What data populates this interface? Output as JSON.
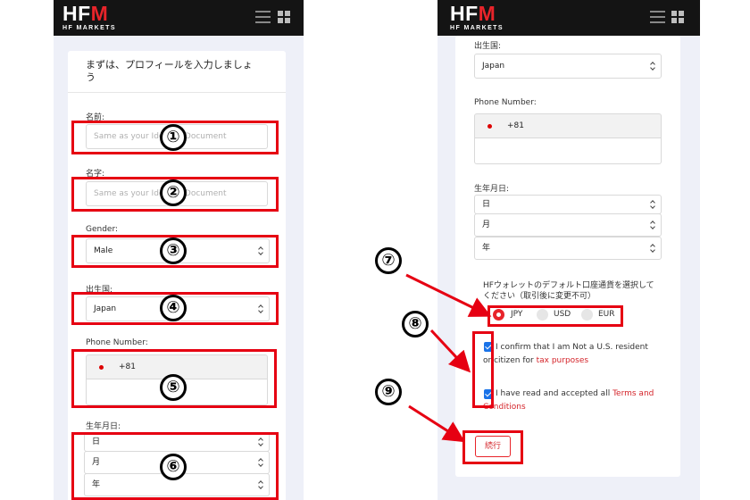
{
  "header": {
    "logo_main_a": "HF",
    "logo_main_b": "M",
    "logo_sub": "HF MARKETS"
  },
  "profile_form": {
    "title": "まずは、プロフィールを入力しましょう",
    "first_name": {
      "label": "名前:",
      "placeholder": "Same as your Identity Document"
    },
    "last_name": {
      "label": "名字:",
      "placeholder": "Same as your Identity Document"
    },
    "gender": {
      "label": "Gender:",
      "value": "Male"
    },
    "country": {
      "label": "出生国:",
      "value": "Japan"
    },
    "phone": {
      "label": "Phone Number:",
      "code": "+81",
      "number": ""
    },
    "birthdate": {
      "label": "生年月日:",
      "day": "日",
      "month": "月",
      "year": "年"
    },
    "currency": {
      "label": "HFウォレットのデフォルト口座通貨を選択してください（取引後に変更不可）",
      "options": [
        "JPY",
        "USD",
        "EUR"
      ],
      "selected": "JPY"
    },
    "consents": {
      "not_us_a": "I confirm that I am Not a U.S. resident or citizen for ",
      "not_us_link": "tax purposes",
      "terms_a": "I have read and accepted all ",
      "terms_link": "Terms and Conditions"
    },
    "continue_label": "続行"
  },
  "annotations": {
    "color": "#e60012",
    "markers": [
      "①",
      "②",
      "③",
      "④",
      "⑤",
      "⑥",
      "⑦",
      "⑧",
      "⑨"
    ]
  }
}
